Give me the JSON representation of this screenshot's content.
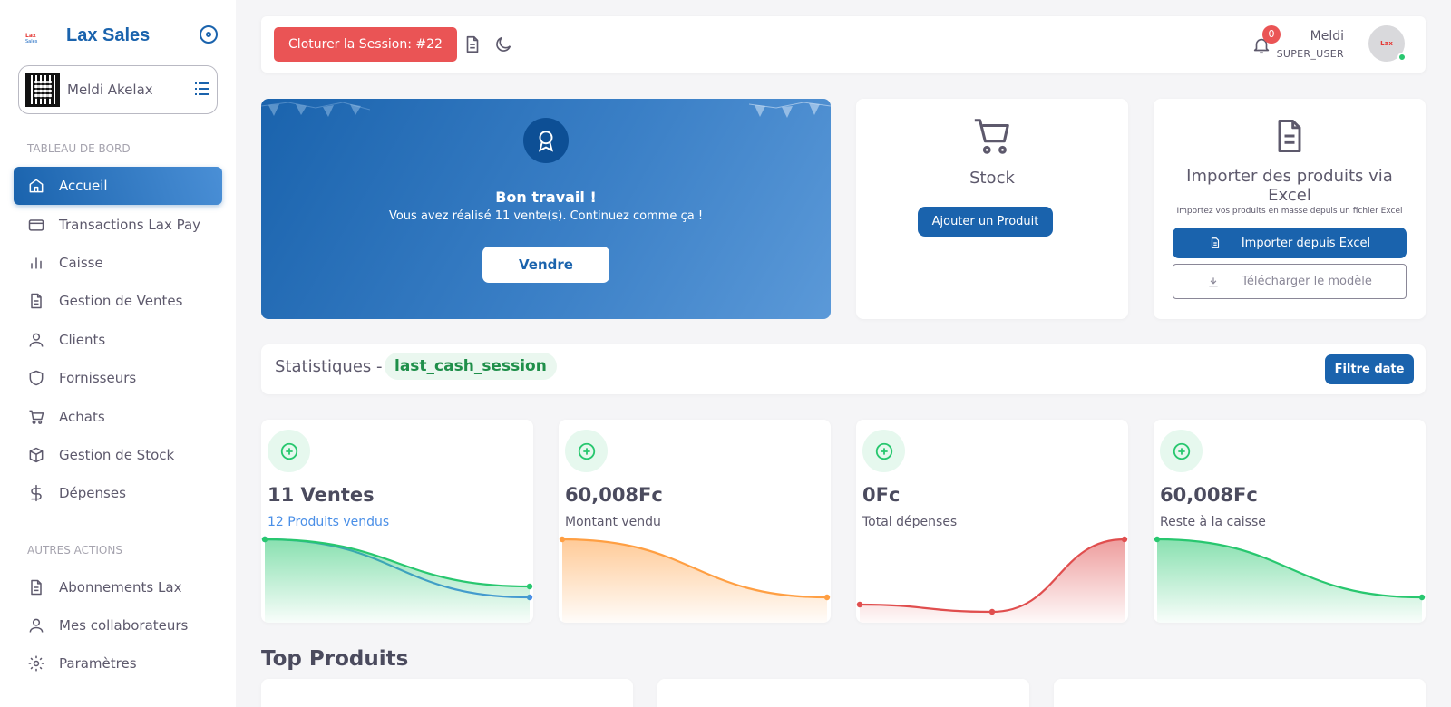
{
  "brand": {
    "title": "Lax Sales",
    "logo_line1": "Lax",
    "logo_line2": "Sales"
  },
  "user_card": {
    "name": "Meldi Akelax"
  },
  "sections": {
    "dashboard": "TABLEAU DE BORD",
    "other": "AUTRES ACTIONS"
  },
  "nav": [
    {
      "label": "Accueil",
      "icon": "home-icon",
      "active": true
    },
    {
      "label": "Transactions Lax Pay",
      "icon": "credit-card-icon"
    },
    {
      "label": "Caisse",
      "icon": "bar-chart-icon"
    },
    {
      "label": "Gestion de Ventes",
      "icon": "file-text-icon"
    },
    {
      "label": "Clients",
      "icon": "user-icon"
    },
    {
      "label": "Fornisseurs",
      "icon": "shield-icon"
    },
    {
      "label": "Achats",
      "icon": "cart-icon"
    },
    {
      "label": "Gestion de Stock",
      "icon": "box-icon"
    },
    {
      "label": "Dépenses",
      "icon": "dollar-icon"
    }
  ],
  "nav_other": [
    {
      "label": "Abonnements Lax",
      "icon": "file-text-icon"
    },
    {
      "label": "Mes collaborateurs",
      "icon": "user-icon"
    },
    {
      "label": "Paramètres",
      "icon": "gear-icon"
    }
  ],
  "topbar": {
    "close_session": "Cloturer la Session: #22",
    "notifications": "0",
    "user_name": "Meldi",
    "user_role": "SUPER_USER"
  },
  "hero": {
    "title": "Bon travail !",
    "text": "Vous avez réalisé 11 vente(s). Continuez comme ça !",
    "button": "Vendre"
  },
  "stock": {
    "title": "Stock",
    "button": "Ajouter un Produit"
  },
  "import": {
    "title": "Importer des produits via Excel",
    "subtitle": "Importez vos produits en masse depuis un fichier Excel",
    "primary": "Importer depuis Excel",
    "secondary": "Télécharger le modèle"
  },
  "stats": {
    "title": "Statistiques -",
    "session": "last_cash_session",
    "filter": "Filtre date"
  },
  "metrics": [
    {
      "value": "11 Ventes",
      "label": "12 Produits vendus",
      "label_color": "blue"
    },
    {
      "value": "60,008Fc",
      "label": "Montant vendu"
    },
    {
      "value": "0Fc",
      "label": "Total dépenses"
    },
    {
      "value": "60,008Fc",
      "label": "Reste à la caisse"
    }
  ],
  "top_products": {
    "title": "Top Produits"
  },
  "colors": {
    "primary": "#1a63ad",
    "danger": "#ea5455",
    "success": "#28c76f",
    "orange": "#ff9f43",
    "blue_series": "#4a8fe7",
    "red_series": "#e04e4e"
  },
  "chart_data": [
    {
      "type": "area",
      "series": [
        {
          "values": [
            1.0,
            0.2
          ]
        },
        {
          "values": [
            1.0,
            0.35
          ]
        }
      ]
    },
    {
      "type": "area",
      "series": [
        {
          "values": [
            1.0,
            0.2
          ]
        }
      ]
    },
    {
      "type": "area",
      "series": [
        {
          "values": [
            0.1,
            0.0,
            1.0
          ]
        }
      ]
    },
    {
      "type": "area",
      "series": [
        {
          "values": [
            1.0,
            0.2
          ]
        }
      ]
    }
  ]
}
